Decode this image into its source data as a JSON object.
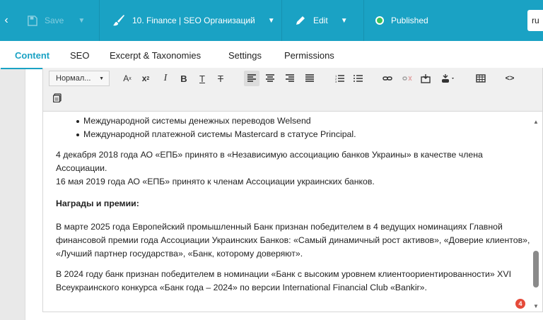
{
  "topbar": {
    "save_label": "Save",
    "title": "10. Finance | SEO Организаций",
    "edit_label": "Edit",
    "status_label": "Published",
    "lang": "ru"
  },
  "tabs": [
    {
      "label": "Content",
      "active": true
    },
    {
      "label": "SEO"
    },
    {
      "label": "Excerpt & Taxonomies"
    },
    {
      "label": "Settings"
    },
    {
      "label": "Permissions"
    }
  ],
  "toolbar": {
    "format_value": "Нормал...",
    "superscript": "A",
    "subscript": "x",
    "italic": "I",
    "bold": "B",
    "underline": "T",
    "strike": "T",
    "source": "<>"
  },
  "content": {
    "bullets": [
      "Международной системы денежных переводов Welsend",
      "Международной платежной системы Mastercard в статусе Principal."
    ],
    "p1": "4 декабря 2018 года АО «ЕПБ» принято в «Независимую ассоциацию банков Украины» в качестве члена Ассоциации.",
    "p2": "16 мая 2019 года АО «ЕПБ» принято к членам Ассоциации украинских банков.",
    "heading": "Награды и премии:",
    "p3": "В марте 2025 года Европейский промышленный Банк признан победителем в 4 ведущих номинациях Главной финансовой премии года Ассоциации Украинских Банков: «Самый динамичный рост активов», «Доверие клиентов», «Лучший партнер государства», «Банк, которому доверяют».",
    "p4": "В 2024 году банк признан победителем в номинации «Банк с высоким уровнем клиентоориентированности» XVI Всеукраинского конкурса «Банк года – 2024» по версии International Financial Club «Bankir»."
  },
  "badge_count": "4",
  "colors": {
    "accent": "#1aa2c4",
    "published": "#39c25a",
    "badge": "#e54a3a"
  }
}
